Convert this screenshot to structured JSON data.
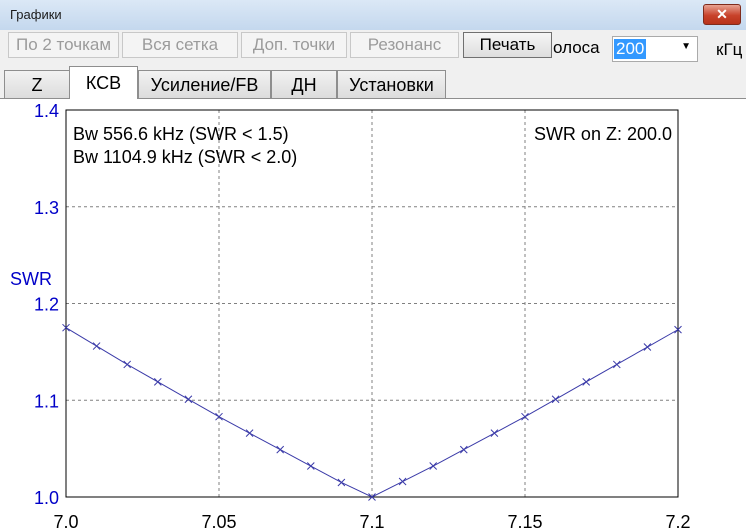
{
  "window": {
    "title": "Графики",
    "close_glyph": "✕"
  },
  "toolbar": {
    "buttons": [
      {
        "label": "По 2 точкам",
        "enabled": false
      },
      {
        "label": "Вся сетка",
        "enabled": false
      },
      {
        "label": "Доп. точки",
        "enabled": false
      },
      {
        "label": "Резонанс",
        "enabled": false
      },
      {
        "label": "Печать",
        "enabled": true
      }
    ],
    "band_label": "олоса",
    "band_value": "200",
    "unit_label": "кГц"
  },
  "tabs": [
    {
      "label": "Z",
      "selected": false
    },
    {
      "label": "КСВ",
      "selected": true
    },
    {
      "label": "Усиление/FB",
      "selected": false
    },
    {
      "label": "ДН",
      "selected": false
    },
    {
      "label": "Установки",
      "selected": false
    }
  ],
  "colors": {
    "axis_labels": "#0000c8",
    "series": "#3a3aa8",
    "grid": "#808080",
    "text": "#000000"
  },
  "chart_data": {
    "type": "line",
    "title": "",
    "xlabel": "",
    "ylabel": "SWR",
    "xlim": [
      7.0,
      7.2
    ],
    "ylim": [
      1.0,
      1.4
    ],
    "x_ticks": [
      "7.0",
      "7.05",
      "7.1",
      "7.15",
      "7.2"
    ],
    "y_ticks": [
      "1.0",
      "1.1",
      "1.2",
      "1.3",
      "1.4"
    ],
    "grid": true,
    "grid_style": "dashed",
    "annotations": {
      "bw_15": "Bw 556.6 kHz (SWR < 1.5)",
      "bw_20": "Bw 1104.9 kHz (SWR < 2.0)",
      "swr_on_z": "SWR on Z: 200.0"
    },
    "series": [
      {
        "marker": "x",
        "x": [
          7.0,
          7.01,
          7.02,
          7.03,
          7.04,
          7.05,
          7.06,
          7.07,
          7.08,
          7.09,
          7.1,
          7.11,
          7.12,
          7.13,
          7.14,
          7.15,
          7.16,
          7.17,
          7.18,
          7.19,
          7.2
        ],
        "y": [
          1.175,
          1.156,
          1.137,
          1.119,
          1.101,
          1.083,
          1.066,
          1.049,
          1.032,
          1.015,
          1.0,
          1.016,
          1.032,
          1.049,
          1.066,
          1.083,
          1.101,
          1.119,
          1.137,
          1.155,
          1.173
        ]
      }
    ]
  }
}
